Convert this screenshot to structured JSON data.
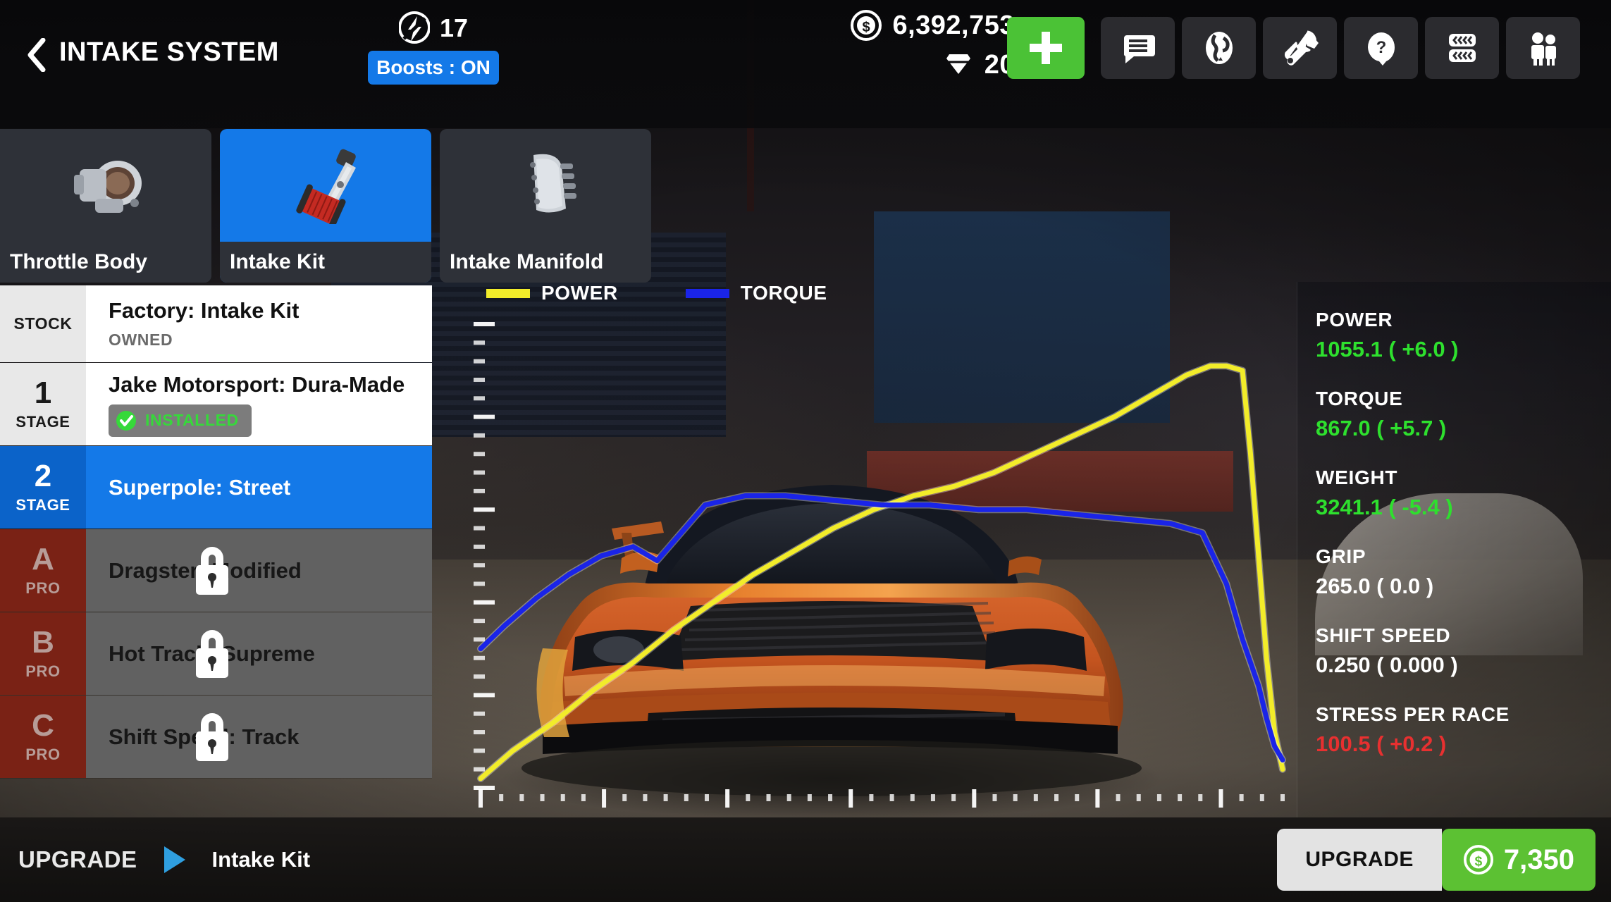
{
  "header": {
    "back_icon": "chevron-left-icon",
    "title": "INTAKE SYSTEM",
    "boost_icon": "boost-bolt-icon",
    "boost_count": "17",
    "boost_toggle_label": "Boosts : ON",
    "cash_icon": "cash-coin-icon",
    "cash_value": "6,392,753",
    "gem_icon": "gem-icon",
    "gem_value": "20",
    "plus_label": "+",
    "icon_buttons": [
      {
        "name": "messages-icon",
        "title": "Messages"
      },
      {
        "name": "globe-icon",
        "title": "World"
      },
      {
        "name": "wrench-icon",
        "title": "Tuning"
      },
      {
        "name": "help-icon",
        "title": "Help"
      },
      {
        "name": "tires-icon",
        "title": "Tires"
      },
      {
        "name": "crew-icon",
        "title": "Crew"
      }
    ]
  },
  "categories": [
    {
      "label": "Throttle Body",
      "icon": "throttle-body-icon",
      "selected": false
    },
    {
      "label": "Intake Kit",
      "icon": "intake-kit-icon",
      "selected": true
    },
    {
      "label": "Intake Manifold",
      "icon": "intake-manifold-icon",
      "selected": false
    }
  ],
  "upgrades": [
    {
      "badge_num": "",
      "badge_txt": "STOCK",
      "title": "Factory: Intake Kit",
      "sub": "OWNED",
      "state": "stock"
    },
    {
      "badge_num": "1",
      "badge_txt": "STAGE",
      "title": "Jake Motorsport: Dura-Made",
      "sub": "INSTALLED",
      "state": "installed"
    },
    {
      "badge_num": "2",
      "badge_txt": "STAGE",
      "title": "Superpole: Street",
      "sub": "",
      "state": "selected"
    },
    {
      "badge_num": "A",
      "badge_txt": "PRO",
      "title": "Dragster: Modified",
      "sub": "",
      "state": "locked"
    },
    {
      "badge_num": "B",
      "badge_txt": "PRO",
      "title": "Hot Track: Supreme",
      "sub": "",
      "state": "locked"
    },
    {
      "badge_num": "C",
      "badge_txt": "PRO",
      "title": "Shift Speed: Track",
      "sub": "",
      "state": "locked"
    }
  ],
  "chart_data": {
    "type": "line",
    "title": "",
    "xlabel": "",
    "ylabel": "",
    "grid": false,
    "legend_position": "top-left",
    "axis_ticks": {
      "x_minor": 40,
      "x_major_every": 6,
      "y_minor": 26,
      "y_major_every": 5
    },
    "series": [
      {
        "name": "POWER",
        "color": "#f2ec2a",
        "x": [
          0,
          4,
          9,
          14,
          19,
          24,
          29,
          34,
          39,
          44,
          49,
          54,
          59,
          64,
          69,
          74,
          79,
          84,
          88,
          91,
          93,
          95,
          96,
          97,
          98,
          99,
          100
        ],
        "y": [
          2,
          8,
          14,
          21,
          27,
          34,
          40,
          46,
          51,
          56,
          60,
          63,
          65,
          68,
          72,
          76,
          80,
          85,
          89,
          91,
          91,
          90,
          72,
          50,
          28,
          12,
          4
        ]
      },
      {
        "name": "TORQUE",
        "color": "#1a24e8",
        "x": [
          0,
          3,
          7,
          11,
          15,
          19,
          22,
          25,
          28,
          33,
          38,
          44,
          50,
          56,
          62,
          68,
          74,
          80,
          86,
          90,
          93,
          95,
          97,
          98,
          99,
          100
        ],
        "y": [
          30,
          35,
          41,
          46,
          50,
          52,
          49,
          55,
          61,
          63,
          63,
          62,
          61,
          61,
          60,
          60,
          59,
          58,
          57,
          55,
          44,
          32,
          22,
          15,
          9,
          6
        ]
      }
    ],
    "legend": [
      {
        "label": "POWER",
        "color": "#f2ec2a"
      },
      {
        "label": "TORQUE",
        "color": "#1a24e8"
      }
    ]
  },
  "stats": [
    {
      "label": "POWER",
      "value": "1055.1 ( +6.0 )",
      "color": "#2ee02e"
    },
    {
      "label": "TORQUE",
      "value": "867.0 ( +5.7 )",
      "color": "#2ee02e"
    },
    {
      "label": "WEIGHT",
      "value": "3241.1 ( -5.4 )",
      "color": "#2ee02e"
    },
    {
      "label": "GRIP",
      "value": "265.0 ( 0.0 )",
      "color": "#ffffff"
    },
    {
      "label": "SHIFT SPEED",
      "value": "0.250 ( 0.000 )",
      "color": "#ffffff"
    },
    {
      "label": "STRESS PER RACE",
      "value": "100.5 ( +0.2 )",
      "color": "#e83030"
    }
  ],
  "footer": {
    "upgrade_word": "UPGRADE",
    "arrow_icon": "play-triangle-icon",
    "part_name": "Intake Kit",
    "buy_label": "UPGRADE",
    "buy_icon": "cash-coin-icon",
    "buy_price": "7,350"
  },
  "colors": {
    "accent_blue": "#1479e8",
    "green": "#4bc236",
    "buy_green": "#5cc133",
    "locked_red": "#7a2215",
    "stat_green": "#2ee02e",
    "stat_red": "#e83030"
  }
}
